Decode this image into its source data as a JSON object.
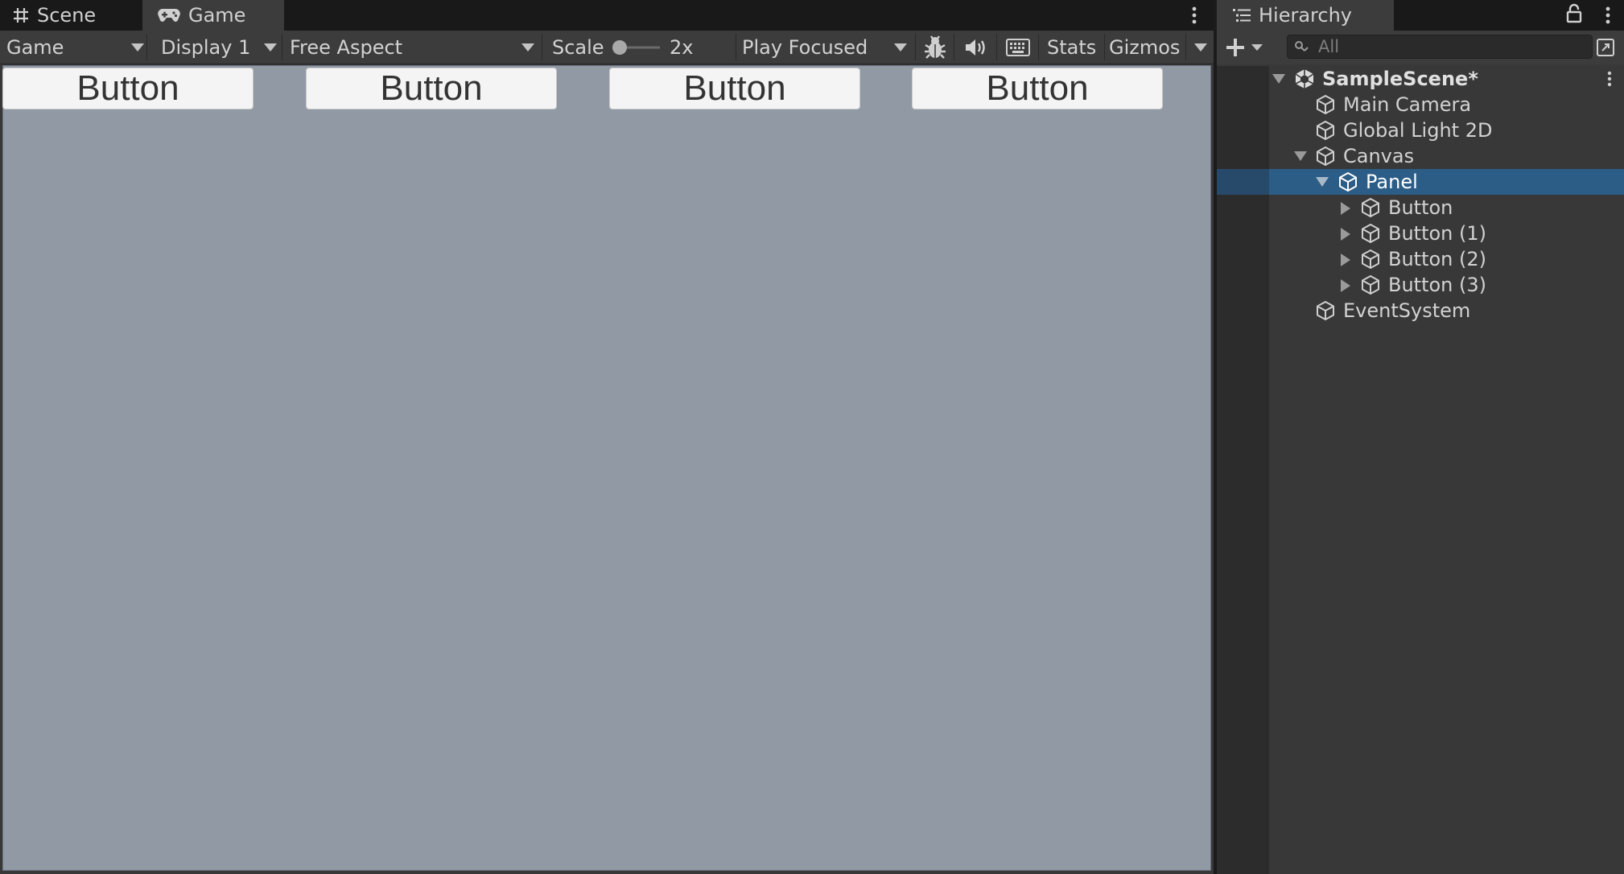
{
  "game": {
    "tabs": {
      "scene": "Scene",
      "game": "Game"
    },
    "toolbar": {
      "view_mode": "Game",
      "display": "Display 1",
      "aspect": "Free Aspect",
      "scale_label": "Scale",
      "scale_value": "2x",
      "play_mode": "Play Focused",
      "stats": "Stats",
      "gizmos": "Gizmos"
    },
    "buttons": [
      "Button",
      "Button",
      "Button",
      "Button"
    ],
    "viewport_color": "#9199a5"
  },
  "hierarchy": {
    "title": "Hierarchy",
    "search_placeholder": "All",
    "scene": "SampleScene*",
    "items": [
      {
        "label": "Main Camera"
      },
      {
        "label": "Global Light 2D"
      },
      {
        "label": "Canvas"
      },
      {
        "label": "Panel"
      },
      {
        "label": "Button"
      },
      {
        "label": "Button (1)"
      },
      {
        "label": "Button (2)"
      },
      {
        "label": "Button (3)"
      },
      {
        "label": "EventSystem"
      }
    ],
    "selection_color": "#2c5d87"
  }
}
